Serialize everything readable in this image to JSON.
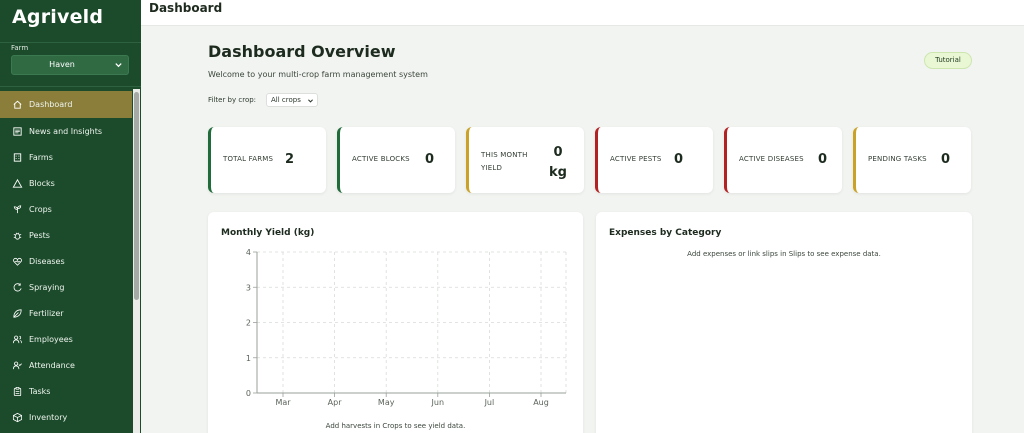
{
  "app": {
    "name": "Agriveld"
  },
  "farm": {
    "label": "Farm",
    "selected": "Haven"
  },
  "nav": [
    {
      "label": "Dashboard",
      "icon": "home-icon",
      "active": true
    },
    {
      "label": "News and Insights",
      "icon": "newspaper-icon"
    },
    {
      "label": "Farms",
      "icon": "building-icon"
    },
    {
      "label": "Blocks",
      "icon": "triangle-icon"
    },
    {
      "label": "Crops",
      "icon": "sprout-icon"
    },
    {
      "label": "Pests",
      "icon": "bug-icon"
    },
    {
      "label": "Diseases",
      "icon": "heart-pulse-icon"
    },
    {
      "label": "Spraying",
      "icon": "spray-icon"
    },
    {
      "label": "Fertilizer",
      "icon": "leaf-icon"
    },
    {
      "label": "Employees",
      "icon": "users-icon"
    },
    {
      "label": "Attendance",
      "icon": "user-check-icon"
    },
    {
      "label": "Tasks",
      "icon": "clipboard-icon"
    },
    {
      "label": "Inventory",
      "icon": "package-icon"
    }
  ],
  "topbar": {
    "title": "Dashboard"
  },
  "main": {
    "title": "Dashboard Overview",
    "subtitle": "Welcome to your multi-crop farm management system",
    "tutorial_label": "Tutorial",
    "filter": {
      "label": "Filter by crop:",
      "value": "All crops"
    }
  },
  "stats": [
    {
      "label": "TOTAL FARMS",
      "value": "2",
      "color": "#1f6b3a"
    },
    {
      "label": "ACTIVE BLOCKS",
      "value": "0",
      "color": "#1f6b3a"
    },
    {
      "label_line1": "THIS MONTH",
      "label_line2": "YIELD",
      "value_line1": "0",
      "value_line2": "kg",
      "color": "#c9a227"
    },
    {
      "label": "ACTIVE PESTS",
      "value": "0",
      "color": "#b22222"
    },
    {
      "label": "ACTIVE DISEASES",
      "value": "0",
      "color": "#b22222"
    },
    {
      "label": "PENDING TASKS",
      "value": "0",
      "color": "#c9a227"
    }
  ],
  "yield_panel": {
    "title": "Monthly Yield (kg)",
    "note": "Add harvests in Crops to see yield data."
  },
  "expenses_panel": {
    "title": "Expenses by Category",
    "note": "Add expenses or link slips in Slips to see expense data."
  },
  "chart_data": {
    "type": "line",
    "title": "Monthly Yield (kg)",
    "categories": [
      "Mar",
      "Apr",
      "May",
      "Jun",
      "Jul",
      "Aug"
    ],
    "series": [],
    "yticks": [
      0,
      1,
      2,
      3,
      4
    ],
    "ylim": [
      0,
      4
    ],
    "grid": true
  }
}
